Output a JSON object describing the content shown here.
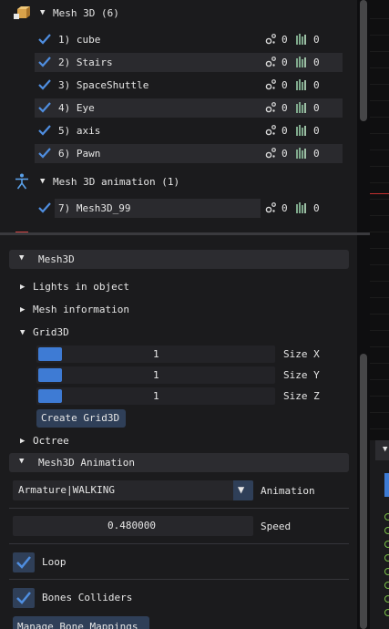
{
  "top": {
    "group1": {
      "label": "Mesh 3D (6)",
      "icon": "cube-icon"
    },
    "items": [
      {
        "label": "1) cube",
        "lights": "0",
        "bones": "0"
      },
      {
        "label": "2) Stairs",
        "lights": "0",
        "bones": "0"
      },
      {
        "label": "3) SpaceShuttle",
        "lights": "0",
        "bones": "0"
      },
      {
        "label": "4) Eye",
        "lights": "0",
        "bones": "0"
      },
      {
        "label": "5) axis",
        "lights": "0",
        "bones": "0"
      },
      {
        "label": "6) Pawn",
        "lights": "0",
        "bones": "0"
      }
    ],
    "group2": {
      "label": "Mesh 3D animation (1)",
      "icon": "person-icon"
    },
    "anim_items": [
      {
        "label": "7) Mesh3D_99",
        "lights": "0",
        "bones": "0"
      }
    ]
  },
  "props": {
    "mesh3d_header": "Mesh3D",
    "lights_in_object": "Lights in object",
    "mesh_information": "Mesh information",
    "grid3d": "Grid3D",
    "size_x": {
      "value": "1",
      "label": "Size X"
    },
    "size_y": {
      "value": "1",
      "label": "Size Y"
    },
    "size_z": {
      "value": "1",
      "label": "Size Z"
    },
    "create_grid": "Create Grid3D",
    "octree": "Octree",
    "anim_header": "Mesh3D Animation",
    "animation_value": "Armature|WALKING",
    "animation_label": "Animation",
    "speed_value": "0.480000",
    "speed_label": "Speed",
    "loop_label": "Loop",
    "bones_colliders_label": "Bones Colliders",
    "manage_bone_mappings": "Manage Bone Mappings"
  },
  "colors": {
    "accent": "#3e7bd4",
    "check": "#4f8ee0",
    "panel": "#1b1b1d"
  }
}
